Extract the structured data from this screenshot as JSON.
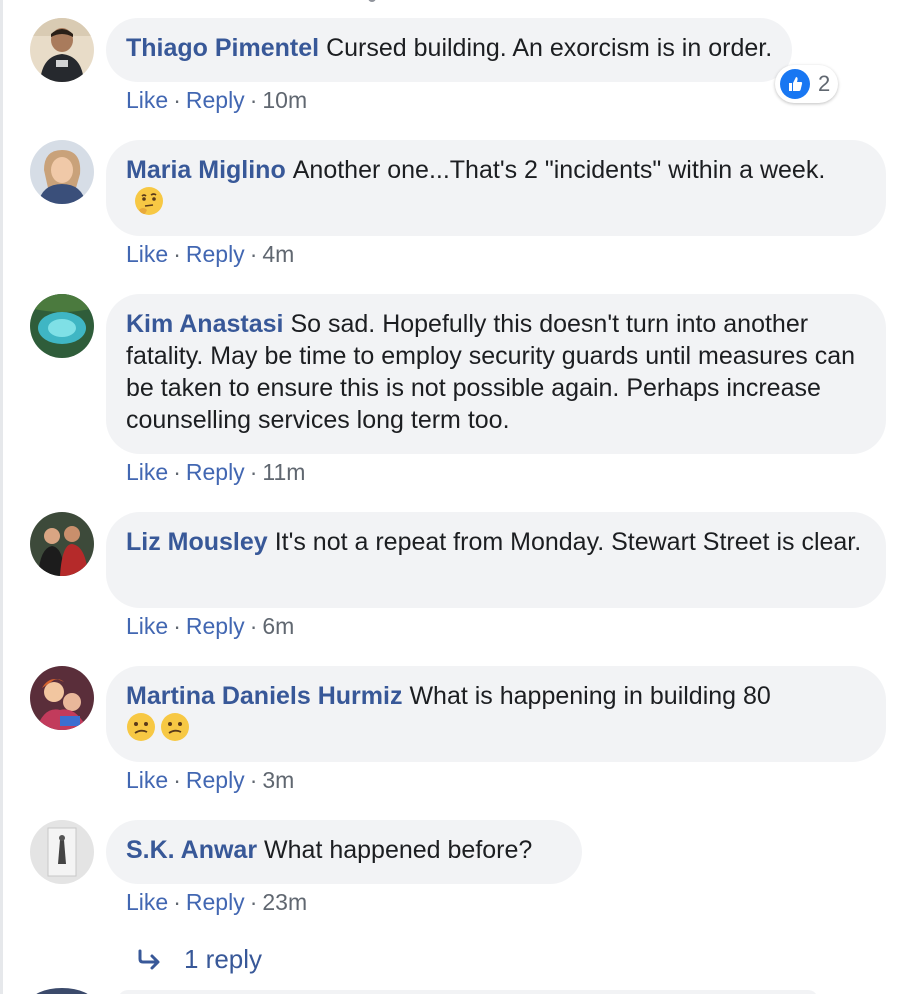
{
  "comments": [
    {
      "author": "Thiago Pimentel",
      "text": "Cursed building. An exorcism is in order.",
      "like_label": "Like",
      "reply_label": "Reply",
      "time": "10m",
      "reaction_count": "2"
    },
    {
      "author": "Maria Miglino",
      "text": "Another one...That's 2 \"incidents\" within a week.",
      "like_label": "Like",
      "reply_label": "Reply",
      "time": "4m",
      "emoji": "thinking-face-emoji"
    },
    {
      "author": "Kim Anastasi",
      "text": "So sad. Hopefully this doesn't turn into another fatality. May be time to employ security guards until measures can be taken to ensure this is not possible again. Perhaps increase counselling services long term too.",
      "like_label": "Like",
      "reply_label": "Reply",
      "time": "11m"
    },
    {
      "author": "Liz Mousley",
      "text": "It's not a repeat from Monday. Stewart Street is clear.",
      "like_label": "Like",
      "reply_label": "Reply",
      "time": "6m"
    },
    {
      "author": "Martina Daniels Hurmiz",
      "text": "What is happening in building 80",
      "like_label": "Like",
      "reply_label": "Reply",
      "time": "3m",
      "emoji": "confused-face-emoji"
    },
    {
      "author": "S.K. Anwar",
      "text": "What happened before?",
      "like_label": "Like",
      "reply_label": "Reply",
      "time": "23m"
    }
  ],
  "replies_link": "1 reply",
  "colors": {
    "author": "#385898",
    "link": "#4267b2",
    "bubble": "#f2f3f5",
    "meta": "#606770",
    "like_blue": "#1877f2"
  }
}
